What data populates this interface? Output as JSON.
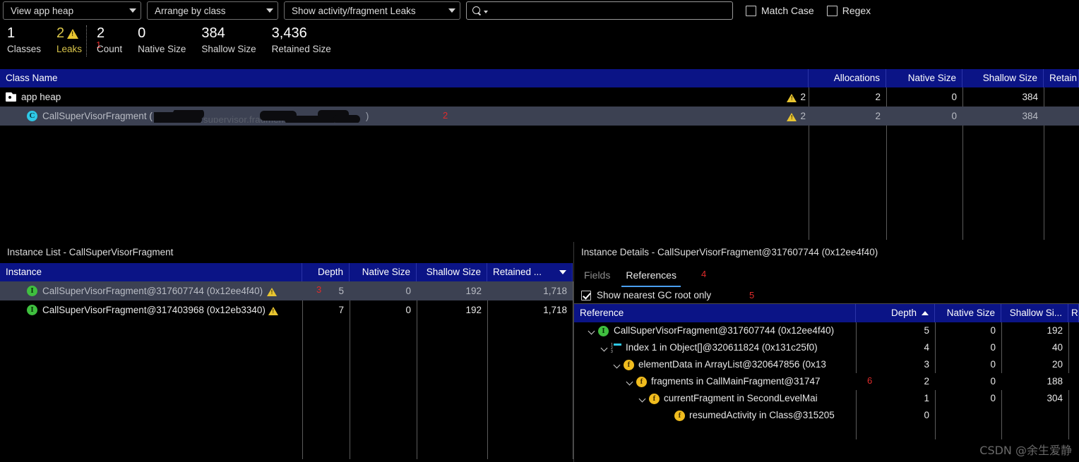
{
  "toolbar": {
    "heap_select": "View app heap",
    "arrange_select": "Arrange by class",
    "leaks_select": "Show activity/fragment Leaks",
    "search_value": "",
    "search_placeholder": "",
    "match_case_label": "Match Case",
    "regex_label": "Regex",
    "match_case_checked": "false",
    "regex_checked": "false"
  },
  "stats": [
    {
      "value": "1",
      "caption": "Classes"
    },
    {
      "value": "2",
      "caption": "Leaks"
    },
    {
      "value": "2",
      "caption": "Count"
    },
    {
      "value": "0",
      "caption": "Native Size"
    },
    {
      "value": "384",
      "caption": "Shallow Size"
    },
    {
      "value": "3,436",
      "caption": "Retained Size"
    }
  ],
  "annotations": {
    "a1": "1",
    "a2": "2",
    "a3": "3",
    "a4": "4",
    "a5": "5",
    "a6": "6"
  },
  "class_table": {
    "headers": [
      "Class Name",
      "",
      "Allocations",
      "Native Size",
      "Shallow Size",
      "Retain"
    ],
    "rows": [
      {
        "name": "app heap",
        "icon": "heap-icon",
        "leak_count": "2",
        "allocations": "2",
        "native_size": "0",
        "shallow_size": "384",
        "retained_size": "",
        "selected": "false"
      },
      {
        "name": "CallSuperVisorFragment (",
        "name_suffix": ")",
        "icon": "class-icon",
        "redacted_package": "com.xxx.xxx.supervisor.fragment.xxx",
        "leak_count": "2",
        "allocations": "2",
        "native_size": "0",
        "shallow_size": "384",
        "retained_size": "",
        "selected": "true"
      }
    ]
  },
  "instance_list": {
    "title": "Instance List - CallSuperVisorFragment",
    "headers": [
      "Instance",
      "Depth",
      "Native Size",
      "Shallow Size",
      "Retained ..."
    ],
    "sort_column": "Retained ...",
    "sort_direction": "desc",
    "rows": [
      {
        "instance": "CallSuperVisorFragment@317607744 (0x12ee4f40)",
        "has_warning": "true",
        "depth": "5",
        "native_size": "0",
        "shallow_size": "192",
        "retained_size": "1,718",
        "selected": "true"
      },
      {
        "instance": "CallSuperVisorFragment@317403968 (0x12eb3340)",
        "has_warning": "true",
        "depth": "7",
        "native_size": "0",
        "shallow_size": "192",
        "retained_size": "1,718",
        "selected": "false"
      }
    ]
  },
  "instance_details": {
    "title": "Instance Details - CallSuperVisorFragment@317607744 (0x12ee4f40)",
    "tabs": [
      {
        "label": "Fields",
        "active": "false"
      },
      {
        "label": "References",
        "active": "true"
      }
    ],
    "gc_root_checkbox": {
      "label": "Show nearest GC root only",
      "checked": "true"
    },
    "headers": [
      "Reference",
      "Depth",
      "Native Size",
      "Shallow Si...",
      "R"
    ],
    "sort_column": "Depth",
    "sort_direction": "asc",
    "rows": [
      {
        "reference": "CallSuperVisorFragment@317607744 (0x12ee4f40)",
        "icon": "instance-icon",
        "indent": "0",
        "expandable": "true",
        "depth": "5",
        "native_size": "0",
        "shallow_size": "192"
      },
      {
        "reference": "Index 1 in Object[]@320611824 (0x131c25f0)",
        "icon": "array-icon",
        "indent": "1",
        "expandable": "true",
        "depth": "4",
        "native_size": "0",
        "shallow_size": "40"
      },
      {
        "reference": "elementData in ArrayList@320647856 (0x13",
        "icon": "field-icon",
        "indent": "2",
        "expandable": "true",
        "depth": "3",
        "native_size": "0",
        "shallow_size": "20"
      },
      {
        "reference": "fragments in CallMainFragment@31747",
        "icon": "field-icon",
        "indent": "3",
        "expandable": "true",
        "depth": "2",
        "native_size": "0",
        "shallow_size": "188"
      },
      {
        "reference": "currentFragment in SecondLevelMai",
        "icon": "field-icon",
        "indent": "4",
        "expandable": "true",
        "depth": "1",
        "native_size": "0",
        "shallow_size": "304"
      },
      {
        "reference": "resumedActivity in Class@315205",
        "icon": "field-icon",
        "indent": "5",
        "expandable": "false",
        "depth": "0",
        "native_size": "",
        "shallow_size": ""
      }
    ]
  },
  "watermark": "CSDN @余生爱静"
}
